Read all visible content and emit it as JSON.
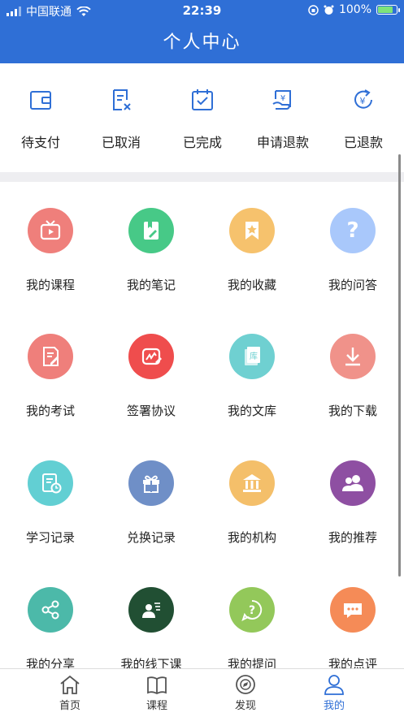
{
  "status_bar": {
    "carrier": "中国联通",
    "time": "22:39",
    "battery": "100%"
  },
  "header": {
    "title": "个人中心"
  },
  "orders": [
    {
      "label": "待支付",
      "icon": "wallet-icon"
    },
    {
      "label": "已取消",
      "icon": "cancel-doc-icon"
    },
    {
      "label": "已完成",
      "icon": "check-calendar-icon"
    },
    {
      "label": "申请退款",
      "icon": "refund-request-icon"
    },
    {
      "label": "已退款",
      "icon": "refunded-icon"
    }
  ],
  "grid": [
    {
      "label": "我的课程",
      "icon": "tv-play-icon",
      "color": "#ef7f7b"
    },
    {
      "label": "我的笔记",
      "icon": "notebook-pen-icon",
      "color": "#47c987"
    },
    {
      "label": "我的收藏",
      "icon": "bookmark-star-icon",
      "color": "#f6c26d"
    },
    {
      "label": "我的问答",
      "icon": "question-icon",
      "color": "#a9c8fb"
    },
    {
      "label": "我的考试",
      "icon": "exam-paper-icon",
      "color": "#ef7f7b"
    },
    {
      "label": "签署协议",
      "icon": "sign-agreement-icon",
      "color": "#ef4d4d"
    },
    {
      "label": "我的文库",
      "icon": "library-book-icon",
      "color": "#6fd0d1"
    },
    {
      "label": "我的下载",
      "icon": "download-icon",
      "color": "#f0928a"
    },
    {
      "label": "学习记录",
      "icon": "study-record-icon",
      "color": "#62cfd3"
    },
    {
      "label": "兑换记录",
      "icon": "gift-icon",
      "color": "#6f8fc7"
    },
    {
      "label": "我的机构",
      "icon": "institution-icon",
      "color": "#f4bf6a"
    },
    {
      "label": "我的推荐",
      "icon": "users-icon",
      "color": "#8e4fa2"
    },
    {
      "label": "我的分享",
      "icon": "share-icon",
      "color": "#4cb9a9"
    },
    {
      "label": "我的线下课",
      "icon": "offline-class-icon",
      "color": "#214f33"
    },
    {
      "label": "我的提问",
      "icon": "ask-question-icon",
      "color": "#93c85a"
    },
    {
      "label": "我的点评",
      "icon": "comment-icon",
      "color": "#f58b57"
    }
  ],
  "tabs": [
    {
      "label": "首页",
      "icon": "home-icon"
    },
    {
      "label": "课程",
      "icon": "book-icon"
    },
    {
      "label": "发现",
      "icon": "compass-icon"
    },
    {
      "label": "我的",
      "icon": "user-icon",
      "active": true
    }
  ],
  "colors": {
    "primary": "#2f6fd6",
    "divider": "#eeeef1"
  }
}
